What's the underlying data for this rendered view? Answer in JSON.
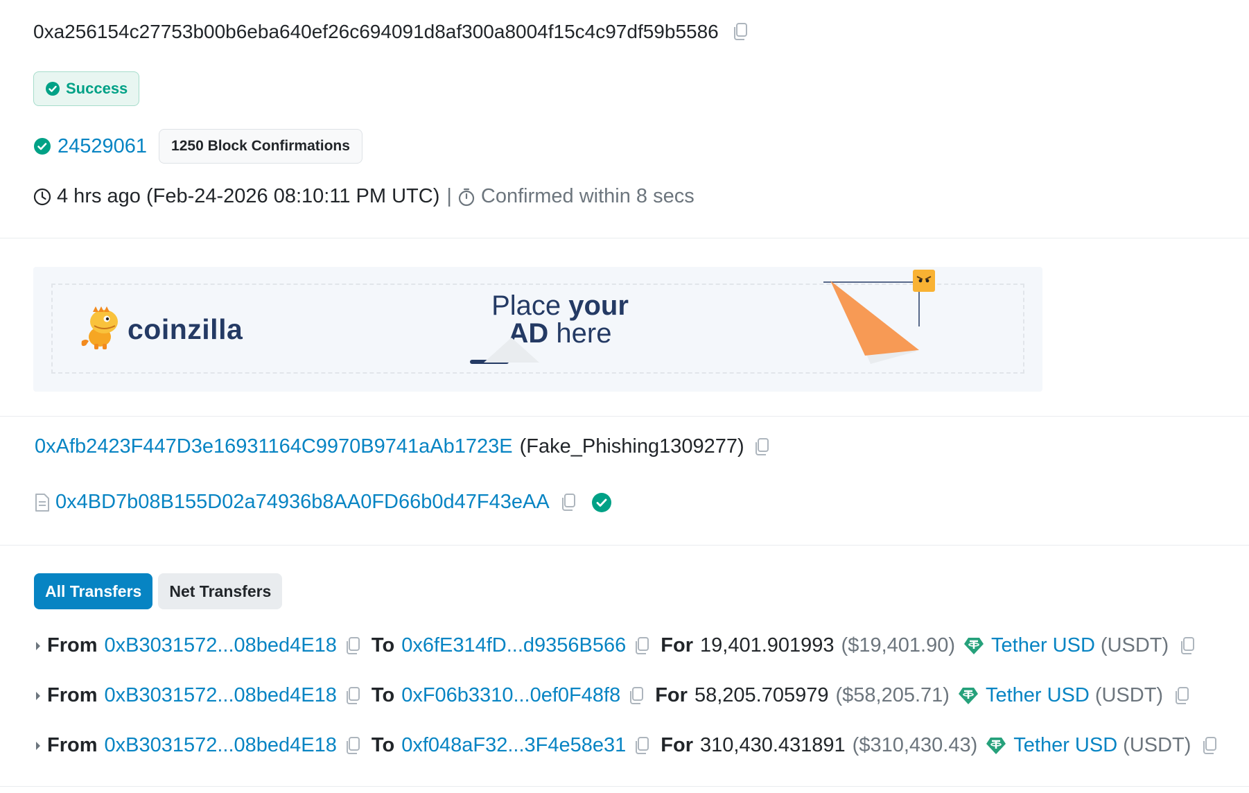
{
  "transaction": {
    "hash": "0xa256154c27753b00b6eba640ef26c694091d8af300a8004f15c4c97df59b5586",
    "status": "Success",
    "block_number": "24529061",
    "block_confirmations": "1250 Block Confirmations",
    "timestamp": "4 hrs ago (Feb-24-2026 08:10:11 PM UTC)",
    "separator": "|",
    "confirmed_within": "Confirmed within 8 secs"
  },
  "ad": {
    "brand": "coinzilla",
    "headline_line1_light": "Place ",
    "headline_line1_bold": "your",
    "headline_line2_bold": "AD",
    "headline_line2_light": " here"
  },
  "from": {
    "address": "0xAfb2423F447D3e16931164C9970B9741aAb1723E",
    "label": "(Fake_Phishing1309277)"
  },
  "interacted_with": {
    "address": "0x4BD7b08B155D02a74936b8AA0FD66b0d47F43eAA"
  },
  "transfer_tabs": [
    {
      "label": "All Transfers",
      "active": true
    },
    {
      "label": "Net Transfers",
      "active": false
    }
  ],
  "transfers": [
    {
      "from_kw": "From",
      "from": "0xB3031572...08bed4E18",
      "to_kw": "To",
      "to": "0x6fE314fD...d9356B566",
      "for_kw": "For",
      "amount": "19,401.901993",
      "usd": "($19,401.90)",
      "token_name": "Tether USD",
      "token_symbol": "(USDT)"
    },
    {
      "from_kw": "From",
      "from": "0xB3031572...08bed4E18",
      "to_kw": "To",
      "to": "0xF06b3310...0ef0F48f8",
      "for_kw": "For",
      "amount": "58,205.705979",
      "usd": "($58,205.71)",
      "token_name": "Tether USD",
      "token_symbol": "(USDT)"
    },
    {
      "from_kw": "From",
      "from": "0xB3031572...08bed4E18",
      "to_kw": "To",
      "to": "0xf048aF32...3F4e58e31",
      "for_kw": "For",
      "amount": "310,430.431891",
      "usd": "($310,430.43)",
      "token_name": "Tether USD",
      "token_symbol": "(USDT)"
    }
  ],
  "colors": {
    "link": "#0784c3",
    "success": "#00a186",
    "tether": "#26a17b",
    "ad_orange": "#f79a55"
  },
  "icons": [
    "copy-icon",
    "check-circle-icon",
    "clock-icon",
    "stopwatch-icon",
    "contract-document-icon",
    "verified-check-icon",
    "caret-right-icon",
    "tether-icon"
  ]
}
